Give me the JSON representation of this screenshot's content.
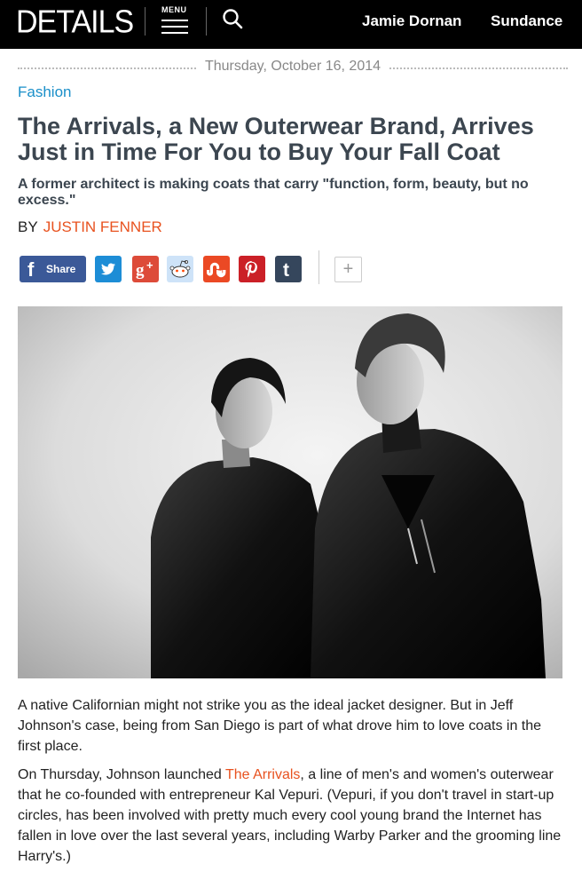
{
  "header": {
    "logo": "DETAILS",
    "menu_label": "MENU",
    "nav": [
      "Jamie Dornan",
      "Sundance"
    ]
  },
  "article": {
    "date": "Thursday, October 16, 2014",
    "section": "Fashion",
    "headline": "The Arrivals, a New Outerwear Brand, Arrives Just in Time For You to Buy Your Fall Coat",
    "dek": "A former architect is making coats that carry \"function, form, beauty, but no excess.\"",
    "by_label": "BY",
    "author": "JUSTIN FENNER",
    "share_label": "Share",
    "more_label": "+",
    "paragraph1": "A native Californian might not strike you as the ideal jacket designer. But in Jeff Johnson's case, being from San Diego is part of what drove him to love coats in the first place.",
    "p2_before": "On Thursday, Johnson launched ",
    "p2_link": "The Arrivals",
    "p2_after": ", a line of men's and women's outerwear that he co-founded with entrepreneur Kal Vepuri. (Vepuri, if you don't travel in start-up circles, has been involved with pretty much every cool young brand the Internet has fallen in love over the last several years, including Warby Parker and the grooming line Harry's.)"
  },
  "share_buttons": [
    {
      "name": "facebook",
      "icon": "facebook-icon",
      "color": "#3b5998"
    },
    {
      "name": "twitter",
      "icon": "twitter-icon",
      "color": "#1d8dd6"
    },
    {
      "name": "google-plus",
      "icon": "google-plus-icon",
      "color": "#dd4b39"
    },
    {
      "name": "reddit",
      "icon": "reddit-icon",
      "color": "#cee3f8"
    },
    {
      "name": "stumbleupon",
      "icon": "stumbleupon-icon",
      "color": "#eb4924"
    },
    {
      "name": "pinterest",
      "icon": "pinterest-icon",
      "color": "#cb2027"
    },
    {
      "name": "tumblr",
      "icon": "tumblr-icon",
      "color": "#35465c"
    }
  ],
  "colors": {
    "accent_link": "#e8521f",
    "section": "#1a8fc9",
    "headline": "#3c4650"
  }
}
